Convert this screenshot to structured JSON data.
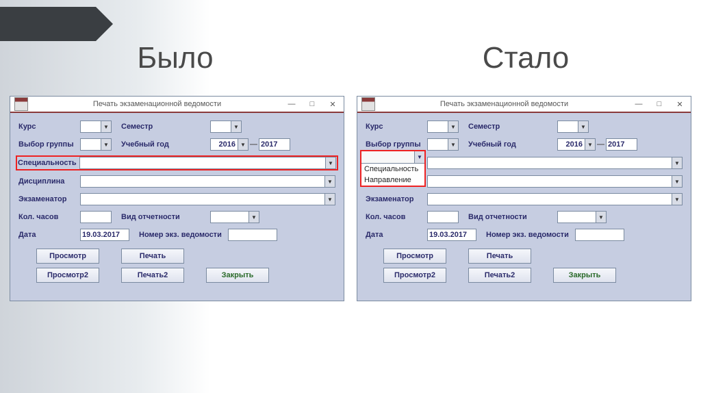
{
  "headings": {
    "before": "Было",
    "after": "Стало"
  },
  "window": {
    "title": "Печать экзаменационной ведомости",
    "controls": {
      "min": "—",
      "max": "□",
      "close": "✕"
    }
  },
  "labels": {
    "kurs": "Курс",
    "vyborGruppy": "Выбор группы",
    "spetsialnost": "Специальность",
    "distsiplina": "Дисциплина",
    "ekzamenator": "Экзаменатор",
    "kolChasov": "Кол. часов",
    "data": "Дата",
    "semestr": "Семестр",
    "uchebnyyGod": "Учебный год",
    "vidOtchetnosti": "Вид отчетности",
    "nomerVedomosti": "Номер экз. ведомости"
  },
  "values": {
    "yearFrom": "2016",
    "yearTo": "2017",
    "data": "19.03.2017"
  },
  "dropdown_items": [
    "Специальность",
    "Направление"
  ],
  "buttons": {
    "prosmotr": "Просмотр",
    "pechat": "Печать",
    "prosmotr2": "Просмотр2",
    "pechat2": "Печать2",
    "zakryt": "Закрыть"
  }
}
